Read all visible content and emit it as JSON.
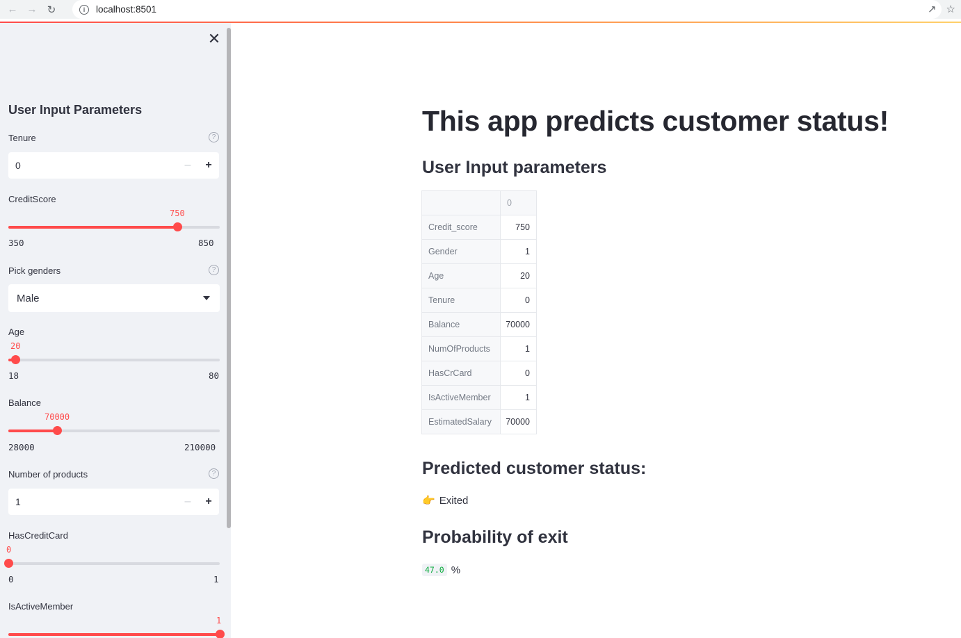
{
  "browser": {
    "url": "localhost:8501"
  },
  "sidebar": {
    "title": "User Input Parameters",
    "tenure": {
      "label": "Tenure",
      "value": "0"
    },
    "credit_score": {
      "label": "CreditScore",
      "value": "750",
      "min": "350",
      "max": "850",
      "fraction": 0.8
    },
    "gender": {
      "label": "Pick genders",
      "value": "Male"
    },
    "age": {
      "label": "Age",
      "value": "20",
      "min": "18",
      "max": "80",
      "fraction": 0.032
    },
    "balance": {
      "label": "Balance",
      "value": "70000",
      "min": "28000",
      "max": "210000",
      "fraction": 0.231
    },
    "products": {
      "label": "Number of products",
      "value": "1"
    },
    "has_credit_card": {
      "label": "HasCreditCard",
      "value": "0",
      "min": "0",
      "max": "1",
      "fraction": 0.0
    },
    "is_active_member": {
      "label": "IsActiveMember",
      "value": "1",
      "fraction": 1.0
    }
  },
  "main": {
    "title": "This app predicts customer status!",
    "params_heading": "User Input parameters",
    "table": {
      "column_header": "0",
      "rows": [
        {
          "name": "Credit_score",
          "value": "750"
        },
        {
          "name": "Gender",
          "value": "1"
        },
        {
          "name": "Age",
          "value": "20"
        },
        {
          "name": "Tenure",
          "value": "0"
        },
        {
          "name": "Balance",
          "value": "70000"
        },
        {
          "name": "NumOfProducts",
          "value": "1"
        },
        {
          "name": "HasCrCard",
          "value": "0"
        },
        {
          "name": "IsActiveMember",
          "value": "1"
        },
        {
          "name": "EstimatedSalary",
          "value": "70000"
        }
      ]
    },
    "prediction_heading": "Predicted customer status:",
    "prediction": "Exited",
    "probability_heading": "Probability of exit",
    "probability_value": "47.0",
    "probability_unit": "%"
  },
  "colors": {
    "accent": "#ff4b4b",
    "sidebar_bg": "#f0f2f6",
    "code_green": "#09ab3b"
  }
}
